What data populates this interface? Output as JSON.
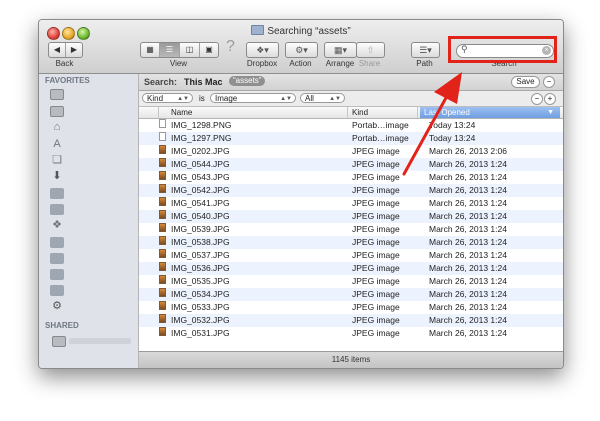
{
  "window": {
    "title": "Searching “assets”"
  },
  "toolbar": {
    "back_label": "Back",
    "view_label": "View",
    "dropbox_label": "Dropbox",
    "action_label": "Action",
    "arrange_label": "Arrange",
    "share_label": "Share",
    "path_label": "Path",
    "search_label": "Search",
    "search_value": ""
  },
  "sidebar": {
    "favorites_header": "FAVORITES",
    "shared_header": "SHARED",
    "icons": [
      "disk-icon",
      "disk-icon",
      "home-icon",
      "applications-icon",
      "documents-icon",
      "downloads-icon",
      "folder-icon",
      "folder-icon",
      "dropbox-icon",
      "folder-icon",
      "folder-icon",
      "folder-icon",
      "folder-icon",
      "gear-icon"
    ]
  },
  "scope": {
    "search_label": "Search:",
    "this_mac": "This Mac",
    "token": "“assets”",
    "save_label": "Save",
    "minus_label": "−"
  },
  "criteria": {
    "attribute": "Kind",
    "operator": "is",
    "value": "Image",
    "subvalue": "All",
    "minus_label": "−",
    "plus_label": "+"
  },
  "columns": {
    "name": "Name",
    "kind": "Kind",
    "last_opened": "Last Opened"
  },
  "files": [
    {
      "name": "IMG_1298.PNG",
      "kind": "Portab…image",
      "date": "Today 13:24",
      "type": "png"
    },
    {
      "name": "IMG_1297.PNG",
      "kind": "Portab…image",
      "date": "Today 13:24",
      "type": "png"
    },
    {
      "name": "IMG_0202.JPG",
      "kind": "JPEG image",
      "date": "March 26, 2013 2:06",
      "type": "jpg"
    },
    {
      "name": "IMG_0544.JPG",
      "kind": "JPEG image",
      "date": "March 26, 2013 1:24",
      "type": "jpg"
    },
    {
      "name": "IMG_0543.JPG",
      "kind": "JPEG image",
      "date": "March 26, 2013 1:24",
      "type": "jpg"
    },
    {
      "name": "IMG_0542.JPG",
      "kind": "JPEG image",
      "date": "March 26, 2013 1:24",
      "type": "jpg"
    },
    {
      "name": "IMG_0541.JPG",
      "kind": "JPEG image",
      "date": "March 26, 2013 1:24",
      "type": "jpg"
    },
    {
      "name": "IMG_0540.JPG",
      "kind": "JPEG image",
      "date": "March 26, 2013 1:24",
      "type": "jpg"
    },
    {
      "name": "IMG_0539.JPG",
      "kind": "JPEG image",
      "date": "March 26, 2013 1:24",
      "type": "jpg"
    },
    {
      "name": "IMG_0538.JPG",
      "kind": "JPEG image",
      "date": "March 26, 2013 1:24",
      "type": "jpg"
    },
    {
      "name": "IMG_0537.JPG",
      "kind": "JPEG image",
      "date": "March 26, 2013 1:24",
      "type": "jpg"
    },
    {
      "name": "IMG_0536.JPG",
      "kind": "JPEG image",
      "date": "March 26, 2013 1:24",
      "type": "jpg"
    },
    {
      "name": "IMG_0535.JPG",
      "kind": "JPEG image",
      "date": "March 26, 2013 1:24",
      "type": "jpg"
    },
    {
      "name": "IMG_0534.JPG",
      "kind": "JPEG image",
      "date": "March 26, 2013 1:24",
      "type": "jpg"
    },
    {
      "name": "IMG_0533.JPG",
      "kind": "JPEG image",
      "date": "March 26, 2013 1:24",
      "type": "jpg"
    },
    {
      "name": "IMG_0532.JPG",
      "kind": "JPEG image",
      "date": "March 26, 2013 1:24",
      "type": "jpg"
    },
    {
      "name": "IMG_0531.JPG",
      "kind": "JPEG image",
      "date": "March 26, 2013 1:24",
      "type": "jpg"
    }
  ],
  "status": {
    "count": "1145 items"
  },
  "colors": {
    "highlight": "#e2231a",
    "arrow": "#e2231a",
    "selected_column": "#7aa6e6",
    "sidebar": "#dfe3e9"
  }
}
